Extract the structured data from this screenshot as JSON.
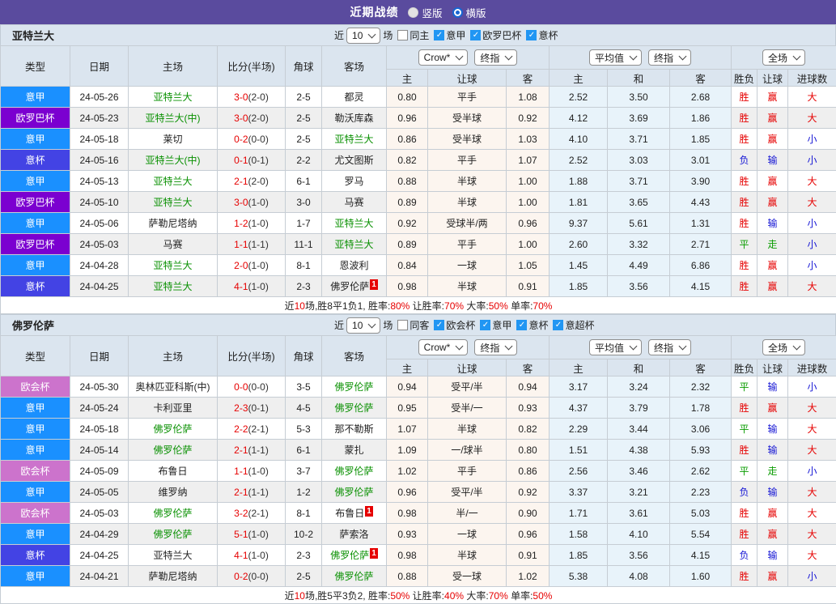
{
  "titlebar": {
    "title": "近期战绩",
    "vertical": "竖版",
    "horizontal": "横版"
  },
  "dropdowns": {
    "odds": "Crow*",
    "odds_index": "终指",
    "avg": "平均值",
    "avg_index": "终指",
    "scope": "全场"
  },
  "table_columns": {
    "type": "类型",
    "date": "日期",
    "home": "主场",
    "score": "比分(半场)",
    "corner": "角球",
    "away": "客场",
    "h": "主",
    "handicap": "让球",
    "a": "客",
    "avg_h": "主",
    "avg_d": "和",
    "avg_a": "客",
    "outcome": "胜负",
    "handicap_col": "让球",
    "goals": "进球数"
  },
  "mark_label": "1",
  "league_colors": {
    "意甲": "#1a90ff",
    "欧罗巴杯": "#7b00d0",
    "意杯": "#4343e4",
    "欧会杯": "#cc73cc"
  },
  "verdict_colors": {
    "胜": "#e60000",
    "负": "#1414d4",
    "平": "#0a9c00",
    "赢": "#e60000",
    "输": "#1414d4",
    "走": "#0a9c00",
    "大": "#e60000",
    "小": "#1414d4"
  },
  "sections": [
    {
      "team": "亚特兰大",
      "filters": {
        "near": "近",
        "count": "10",
        "unit": "场",
        "unchecked_label": "同主",
        "checked": [
          "意甲",
          "欧罗巴杯",
          "意杯"
        ]
      },
      "rows": [
        {
          "league": "意甲",
          "date": "24-05-26",
          "home": "亚特兰大",
          "home_focus": true,
          "home_mark": false,
          "score": "3-0",
          "half": "(2-0)",
          "corners": "2-5",
          "away": "都灵",
          "away_focus": false,
          "away_mark": false,
          "crow_home": "0.80",
          "handicap": "平手",
          "crow_away": "1.08",
          "avg_home": "2.52",
          "avg_draw": "3.50",
          "avg_away": "2.68",
          "outcome": "胜",
          "handicap_outcome": "赢",
          "goals_outcome": "大"
        },
        {
          "league": "欧罗巴杯",
          "date": "24-05-23",
          "home": "亚特兰大(中)",
          "home_focus": true,
          "home_mark": false,
          "score": "3-0",
          "half": "(2-0)",
          "corners": "2-5",
          "away": "勒沃库森",
          "away_focus": false,
          "away_mark": false,
          "crow_home": "0.96",
          "handicap": "受半球",
          "crow_away": "0.92",
          "avg_home": "4.12",
          "avg_draw": "3.69",
          "avg_away": "1.86",
          "outcome": "胜",
          "handicap_outcome": "赢",
          "goals_outcome": "大"
        },
        {
          "league": "意甲",
          "date": "24-05-18",
          "home": "莱切",
          "home_focus": false,
          "home_mark": false,
          "score": "0-2",
          "half": "(0-0)",
          "corners": "2-5",
          "away": "亚特兰大",
          "away_focus": true,
          "away_mark": false,
          "crow_home": "0.86",
          "handicap": "受半球",
          "crow_away": "1.03",
          "avg_home": "4.10",
          "avg_draw": "3.71",
          "avg_away": "1.85",
          "outcome": "胜",
          "handicap_outcome": "赢",
          "goals_outcome": "小"
        },
        {
          "league": "意杯",
          "date": "24-05-16",
          "home": "亚特兰大(中)",
          "home_focus": true,
          "home_mark": false,
          "score": "0-1",
          "half": "(0-1)",
          "corners": "2-2",
          "away": "尤文图斯",
          "away_focus": false,
          "away_mark": false,
          "crow_home": "0.82",
          "handicap": "平手",
          "crow_away": "1.07",
          "avg_home": "2.52",
          "avg_draw": "3.03",
          "avg_away": "3.01",
          "outcome": "负",
          "handicap_outcome": "输",
          "goals_outcome": "小"
        },
        {
          "league": "意甲",
          "date": "24-05-13",
          "home": "亚特兰大",
          "home_focus": true,
          "home_mark": false,
          "score": "2-1",
          "half": "(2-0)",
          "corners": "6-1",
          "away": "罗马",
          "away_focus": false,
          "away_mark": false,
          "crow_home": "0.88",
          "handicap": "半球",
          "crow_away": "1.00",
          "avg_home": "1.88",
          "avg_draw": "3.71",
          "avg_away": "3.90",
          "outcome": "胜",
          "handicap_outcome": "赢",
          "goals_outcome": "大"
        },
        {
          "league": "欧罗巴杯",
          "date": "24-05-10",
          "home": "亚特兰大",
          "home_focus": true,
          "home_mark": false,
          "score": "3-0",
          "half": "(1-0)",
          "corners": "3-0",
          "away": "马赛",
          "away_focus": false,
          "away_mark": false,
          "crow_home": "0.89",
          "handicap": "半球",
          "crow_away": "1.00",
          "avg_home": "1.81",
          "avg_draw": "3.65",
          "avg_away": "4.43",
          "outcome": "胜",
          "handicap_outcome": "赢",
          "goals_outcome": "大"
        },
        {
          "league": "意甲",
          "date": "24-05-06",
          "home": "萨勒尼塔纳",
          "home_focus": false,
          "home_mark": false,
          "score": "1-2",
          "half": "(1-0)",
          "corners": "1-7",
          "away": "亚特兰大",
          "away_focus": true,
          "away_mark": false,
          "crow_home": "0.92",
          "handicap": "受球半/两",
          "crow_away": "0.96",
          "avg_home": "9.37",
          "avg_draw": "5.61",
          "avg_away": "1.31",
          "outcome": "胜",
          "handicap_outcome": "输",
          "goals_outcome": "小"
        },
        {
          "league": "欧罗巴杯",
          "date": "24-05-03",
          "home": "马赛",
          "home_focus": false,
          "home_mark": false,
          "score": "1-1",
          "half": "(1-1)",
          "corners": "11-1",
          "away": "亚特兰大",
          "away_focus": true,
          "away_mark": false,
          "crow_home": "0.89",
          "handicap": "平手",
          "crow_away": "1.00",
          "avg_home": "2.60",
          "avg_draw": "3.32",
          "avg_away": "2.71",
          "outcome": "平",
          "handicap_outcome": "走",
          "goals_outcome": "小"
        },
        {
          "league": "意甲",
          "date": "24-04-28",
          "home": "亚特兰大",
          "home_focus": true,
          "home_mark": false,
          "score": "2-0",
          "half": "(1-0)",
          "corners": "8-1",
          "away": "恩波利",
          "away_focus": false,
          "away_mark": false,
          "crow_home": "0.84",
          "handicap": "一球",
          "crow_away": "1.05",
          "avg_home": "1.45",
          "avg_draw": "4.49",
          "avg_away": "6.86",
          "outcome": "胜",
          "handicap_outcome": "赢",
          "goals_outcome": "小"
        },
        {
          "league": "意杯",
          "date": "24-04-25",
          "home": "亚特兰大",
          "home_focus": true,
          "home_mark": false,
          "score": "4-1",
          "half": "(1-0)",
          "corners": "2-3",
          "away": "佛罗伦萨",
          "away_focus": false,
          "away_mark": true,
          "crow_home": "0.98",
          "handicap": "半球",
          "crow_away": "0.91",
          "avg_home": "1.85",
          "avg_draw": "3.56",
          "avg_away": "4.15",
          "outcome": "胜",
          "handicap_outcome": "赢",
          "goals_outcome": "大"
        }
      ],
      "summary": [
        {
          "t": "近"
        },
        {
          "t": "10",
          "red": true
        },
        {
          "t": "场,胜8平1负1, 胜率:"
        },
        {
          "t": "80%",
          "red": true
        },
        {
          "t": " 让胜率:"
        },
        {
          "t": "70%",
          "red": true
        },
        {
          "t": " 大率:"
        },
        {
          "t": "50%",
          "red": true
        },
        {
          "t": " 单率:"
        },
        {
          "t": "70%",
          "red": true
        }
      ]
    },
    {
      "team": "佛罗伦萨",
      "filters": {
        "near": "近",
        "count": "10",
        "unit": "场",
        "unchecked_label": "同客",
        "checked": [
          "欧会杯",
          "意甲",
          "意杯",
          "意超杯"
        ]
      },
      "rows": [
        {
          "league": "欧会杯",
          "date": "24-05-30",
          "home": "奥林匹亚科斯(中)",
          "home_focus": false,
          "home_mark": false,
          "score": "0-0",
          "half": "(0-0)",
          "corners": "3-5",
          "away": "佛罗伦萨",
          "away_focus": true,
          "away_mark": false,
          "crow_home": "0.94",
          "handicap": "受平/半",
          "crow_away": "0.94",
          "avg_home": "3.17",
          "avg_draw": "3.24",
          "avg_away": "2.32",
          "outcome": "平",
          "handicap_outcome": "输",
          "goals_outcome": "小"
        },
        {
          "league": "意甲",
          "date": "24-05-24",
          "home": "卡利亚里",
          "home_focus": false,
          "home_mark": false,
          "score": "2-3",
          "half": "(0-1)",
          "corners": "4-5",
          "away": "佛罗伦萨",
          "away_focus": true,
          "away_mark": false,
          "crow_home": "0.95",
          "handicap": "受半/一",
          "crow_away": "0.93",
          "avg_home": "4.37",
          "avg_draw": "3.79",
          "avg_away": "1.78",
          "outcome": "胜",
          "handicap_outcome": "赢",
          "goals_outcome": "大"
        },
        {
          "league": "意甲",
          "date": "24-05-18",
          "home": "佛罗伦萨",
          "home_focus": true,
          "home_mark": false,
          "score": "2-2",
          "half": "(2-1)",
          "corners": "5-3",
          "away": "那不勒斯",
          "away_focus": false,
          "away_mark": false,
          "crow_home": "1.07",
          "handicap": "半球",
          "crow_away": "0.82",
          "avg_home": "2.29",
          "avg_draw": "3.44",
          "avg_away": "3.06",
          "outcome": "平",
          "handicap_outcome": "输",
          "goals_outcome": "大"
        },
        {
          "league": "意甲",
          "date": "24-05-14",
          "home": "佛罗伦萨",
          "home_focus": true,
          "home_mark": false,
          "score": "2-1",
          "half": "(1-1)",
          "corners": "6-1",
          "away": "蒙扎",
          "away_focus": false,
          "away_mark": false,
          "crow_home": "1.09",
          "handicap": "一/球半",
          "crow_away": "0.80",
          "avg_home": "1.51",
          "avg_draw": "4.38",
          "avg_away": "5.93",
          "outcome": "胜",
          "handicap_outcome": "输",
          "goals_outcome": "大"
        },
        {
          "league": "欧会杯",
          "date": "24-05-09",
          "home": "布鲁日",
          "home_focus": false,
          "home_mark": false,
          "score": "1-1",
          "half": "(1-0)",
          "corners": "3-7",
          "away": "佛罗伦萨",
          "away_focus": true,
          "away_mark": false,
          "crow_home": "1.02",
          "handicap": "平手",
          "crow_away": "0.86",
          "avg_home": "2.56",
          "avg_draw": "3.46",
          "avg_away": "2.62",
          "outcome": "平",
          "handicap_outcome": "走",
          "goals_outcome": "小"
        },
        {
          "league": "意甲",
          "date": "24-05-05",
          "home": "维罗纳",
          "home_focus": false,
          "home_mark": false,
          "score": "2-1",
          "half": "(1-1)",
          "corners": "1-2",
          "away": "佛罗伦萨",
          "away_focus": true,
          "away_mark": false,
          "crow_home": "0.96",
          "handicap": "受平/半",
          "crow_away": "0.92",
          "avg_home": "3.37",
          "avg_draw": "3.21",
          "avg_away": "2.23",
          "outcome": "负",
          "handicap_outcome": "输",
          "goals_outcome": "大"
        },
        {
          "league": "欧会杯",
          "date": "24-05-03",
          "home": "佛罗伦萨",
          "home_focus": true,
          "home_mark": false,
          "score": "3-2",
          "half": "(2-1)",
          "corners": "8-1",
          "away": "布鲁日",
          "away_focus": false,
          "away_mark": true,
          "crow_home": "0.98",
          "handicap": "半/一",
          "crow_away": "0.90",
          "avg_home": "1.71",
          "avg_draw": "3.61",
          "avg_away": "5.03",
          "outcome": "胜",
          "handicap_outcome": "赢",
          "goals_outcome": "大"
        },
        {
          "league": "意甲",
          "date": "24-04-29",
          "home": "佛罗伦萨",
          "home_focus": true,
          "home_mark": false,
          "score": "5-1",
          "half": "(1-0)",
          "corners": "10-2",
          "away": "萨索洛",
          "away_focus": false,
          "away_mark": false,
          "crow_home": "0.93",
          "handicap": "一球",
          "crow_away": "0.96",
          "avg_home": "1.58",
          "avg_draw": "4.10",
          "avg_away": "5.54",
          "outcome": "胜",
          "handicap_outcome": "赢",
          "goals_outcome": "大"
        },
        {
          "league": "意杯",
          "date": "24-04-25",
          "home": "亚特兰大",
          "home_focus": false,
          "home_mark": false,
          "score": "4-1",
          "half": "(1-0)",
          "corners": "2-3",
          "away": "佛罗伦萨",
          "away_focus": true,
          "away_mark": true,
          "crow_home": "0.98",
          "handicap": "半球",
          "crow_away": "0.91",
          "avg_home": "1.85",
          "avg_draw": "3.56",
          "avg_away": "4.15",
          "outcome": "负",
          "handicap_outcome": "输",
          "goals_outcome": "大"
        },
        {
          "league": "意甲",
          "date": "24-04-21",
          "home": "萨勒尼塔纳",
          "home_focus": false,
          "home_mark": false,
          "score": "0-2",
          "half": "(0-0)",
          "corners": "2-5",
          "away": "佛罗伦萨",
          "away_focus": true,
          "away_mark": false,
          "crow_home": "0.88",
          "handicap": "受一球",
          "crow_away": "1.02",
          "avg_home": "5.38",
          "avg_draw": "4.08",
          "avg_away": "1.60",
          "outcome": "胜",
          "handicap_outcome": "赢",
          "goals_outcome": "小"
        }
      ],
      "summary": [
        {
          "t": "近"
        },
        {
          "t": "10",
          "red": true
        },
        {
          "t": "场,胜5平3负2, 胜率:"
        },
        {
          "t": "50%",
          "red": true
        },
        {
          "t": " 让胜率:"
        },
        {
          "t": "40%",
          "red": true
        },
        {
          "t": " 大率:"
        },
        {
          "t": "70%",
          "red": true
        },
        {
          "t": " 单率:"
        },
        {
          "t": "50%",
          "red": true
        }
      ]
    }
  ]
}
